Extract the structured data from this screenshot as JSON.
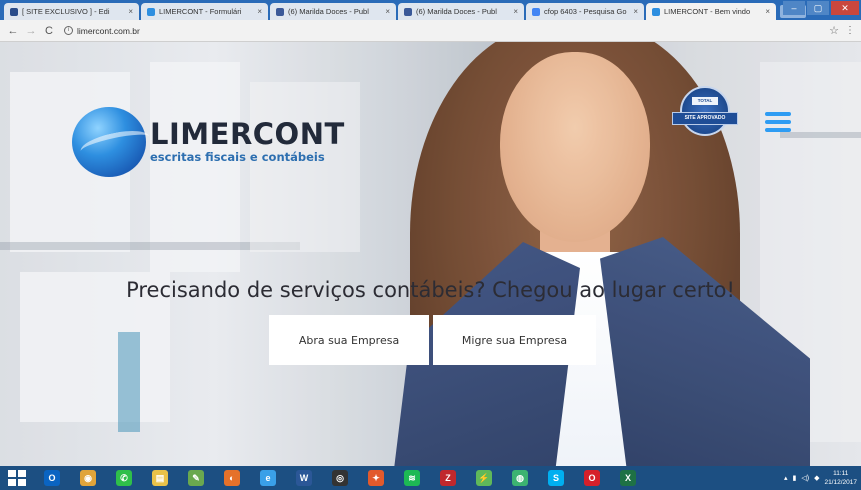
{
  "browser": {
    "tabs": [
      {
        "label": "[ SITE EXCLUSIVO ] - Edi",
        "favicon_color": "#2a4c8a",
        "active": false
      },
      {
        "label": "LIMERCONT - Formulári",
        "favicon_color": "#2e8fe0",
        "active": false
      },
      {
        "label": "(6) Marilda Doces - Publ",
        "favicon_color": "#3b5998",
        "active": false
      },
      {
        "label": "(6) Marilda Doces - Publ",
        "favicon_color": "#3b5998",
        "active": false
      },
      {
        "label": "cfop 6403 - Pesquisa Go",
        "favicon_color": "#4285f4",
        "active": false
      },
      {
        "label": "LIMERCONT - Bem vindo",
        "favicon_color": "#2e8fe0",
        "active": true
      }
    ],
    "tab_close": "×",
    "back": "←",
    "forward": "→",
    "reload": "C",
    "url": "limercont.com.br",
    "win_min": "–",
    "win_max": "▢",
    "win_close": "✕"
  },
  "site": {
    "logo_name": "LIMERCONT",
    "logo_tagline": "escritas fiscais e contábeis",
    "seal_top": "TOTAL",
    "seal_ribbon": "SITE APROVADO",
    "hero_title": "Precisando de serviços contábeis? Chegou ao lugar certo!",
    "cta_primary": "Abra sua Empresa",
    "cta_secondary": "Migre sua Empresa"
  },
  "taskbar": {
    "icons": [
      {
        "name": "outlook-icon",
        "color": "#0a64c2",
        "glyph": "O"
      },
      {
        "name": "chrome-icon",
        "color": "#e0a43a",
        "glyph": "◉"
      },
      {
        "name": "whatsapp-icon",
        "color": "#2fbf4a",
        "glyph": "✆"
      },
      {
        "name": "file-explorer-icon",
        "color": "#e8c24a",
        "glyph": "▤"
      },
      {
        "name": "paint-icon",
        "color": "#6aa84f",
        "glyph": "✎"
      },
      {
        "name": "firefox-icon",
        "color": "#e5712a",
        "glyph": "◐"
      },
      {
        "name": "internet-explorer-icon",
        "color": "#3aa0e8",
        "glyph": "e"
      },
      {
        "name": "word-icon",
        "color": "#2b5797",
        "glyph": "W"
      },
      {
        "name": "obs-icon",
        "color": "#333333",
        "glyph": "◎"
      },
      {
        "name": "paint3d-icon",
        "color": "#e25a2c",
        "glyph": "✦"
      },
      {
        "name": "spotify-icon",
        "color": "#1db954",
        "glyph": "≋"
      },
      {
        "name": "filezilla-icon",
        "color": "#c0282d",
        "glyph": "Z"
      },
      {
        "name": "lightning-icon",
        "color": "#5fb85a",
        "glyph": "⚡"
      },
      {
        "name": "globe-icon",
        "color": "#3cb371",
        "glyph": "◍"
      },
      {
        "name": "skype-icon",
        "color": "#00aff0",
        "glyph": "S"
      },
      {
        "name": "opera-icon",
        "color": "#d6202a",
        "glyph": "O"
      },
      {
        "name": "excel-icon",
        "color": "#1e7145",
        "glyph": "X"
      }
    ],
    "clock_time": "11:11",
    "clock_date": "21/12/2017"
  }
}
